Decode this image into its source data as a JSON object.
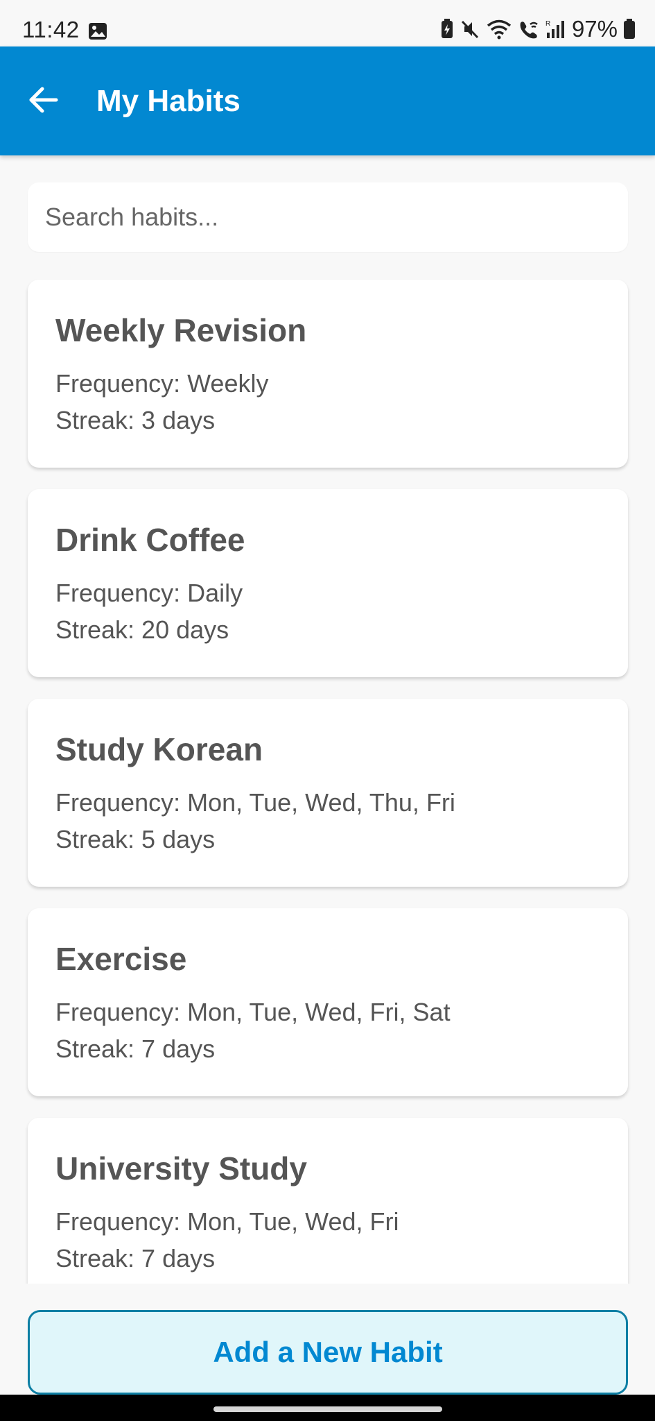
{
  "status_bar": {
    "time": "11:42",
    "battery": "97%",
    "icons": [
      "image-icon",
      "battery-saver-icon",
      "mute-icon",
      "wifi-icon",
      "wifi-calling-icon",
      "signal-icon",
      "battery-icon"
    ]
  },
  "app_bar": {
    "title": "My Habits",
    "color": "#0288d1"
  },
  "search": {
    "placeholder": "Search habits...",
    "value": ""
  },
  "habits": [
    {
      "name": "Weekly Revision",
      "frequency": "Frequency: Weekly",
      "streak": "Streak: 3 days"
    },
    {
      "name": "Drink Coffee",
      "frequency": "Frequency: Daily",
      "streak": "Streak: 20 days"
    },
    {
      "name": "Study Korean",
      "frequency": "Frequency: Mon, Tue, Wed, Thu, Fri",
      "streak": "Streak: 5 days"
    },
    {
      "name": "Exercise",
      "frequency": "Frequency: Mon, Tue, Wed, Fri, Sat",
      "streak": "Streak: 7 days"
    },
    {
      "name": "University Study",
      "frequency": "Frequency: Mon, Tue, Wed, Fri",
      "streak": "Streak: 7 days"
    }
  ],
  "add_button": {
    "label": "Add a New Habit",
    "background": "#e0f6fa",
    "border": "#0e7fa4",
    "text_color": "#0288d1"
  }
}
